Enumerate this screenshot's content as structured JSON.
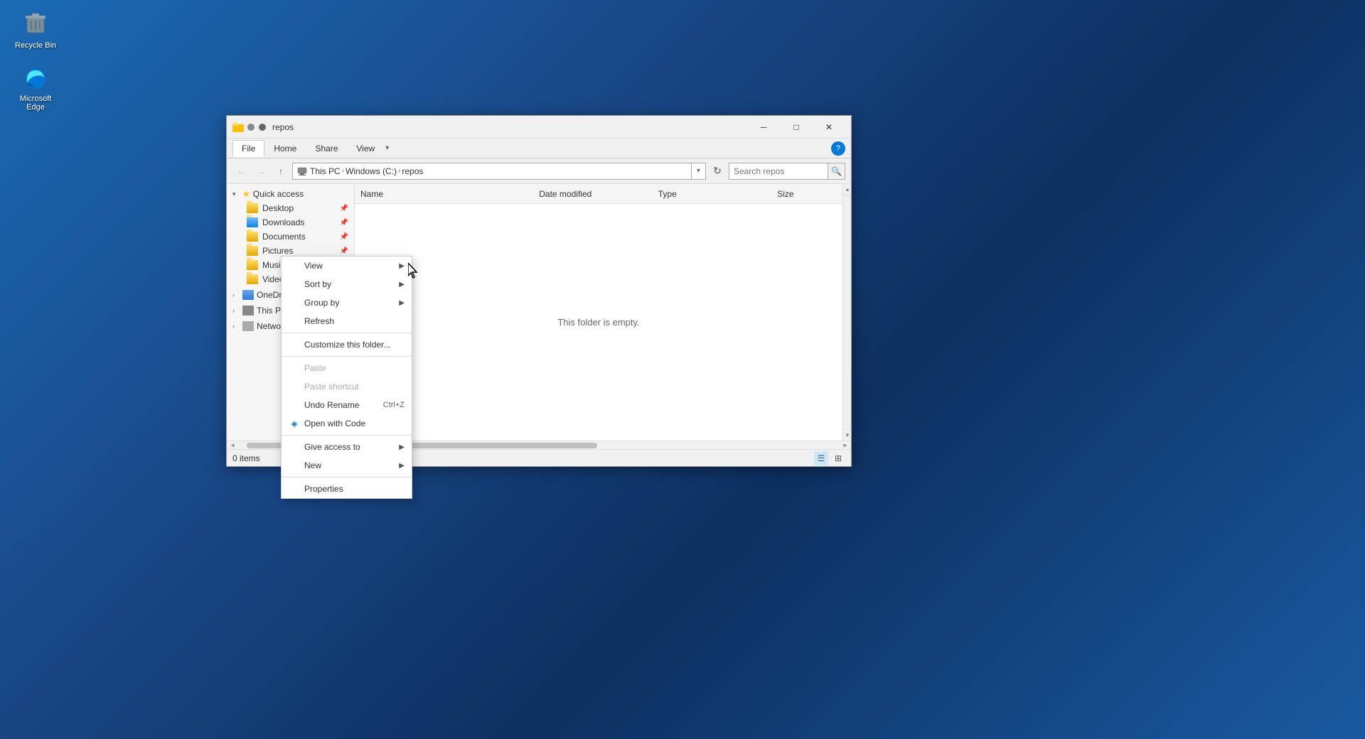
{
  "desktop": {
    "recyclebin": {
      "label": "Recycle Bin"
    },
    "edge": {
      "label": "Microsoft Edge"
    }
  },
  "window": {
    "title": "repos",
    "titlebar": {
      "minimize": "─",
      "maximize": "□",
      "close": "✕"
    },
    "tabs": [
      {
        "label": "File",
        "active": true
      },
      {
        "label": "Home",
        "active": false
      },
      {
        "label": "Share",
        "active": false
      },
      {
        "label": "View",
        "active": false
      }
    ],
    "address": {
      "path_parts": [
        "This PC",
        "Windows (C:)",
        "repos"
      ],
      "search_placeholder": "Search repos",
      "search_value": ""
    },
    "sidebar": {
      "sections": [
        {
          "label": "Quick access",
          "expanded": true,
          "items": [
            {
              "label": "Desktop",
              "pinned": true
            },
            {
              "label": "Downloads",
              "pinned": true
            },
            {
              "label": "Documents",
              "pinned": true
            },
            {
              "label": "Pictures",
              "pinned": true
            },
            {
              "label": "Music",
              "pinned": false
            },
            {
              "label": "Videos",
              "pinned": false
            }
          ]
        },
        {
          "label": "OneDrive",
          "expanded": false,
          "items": []
        },
        {
          "label": "This PC",
          "expanded": false,
          "items": []
        },
        {
          "label": "Network",
          "expanded": false,
          "items": []
        }
      ]
    },
    "content": {
      "columns": [
        "Name",
        "Date modified",
        "Type",
        "Size"
      ],
      "empty_message": "This folder is empty."
    },
    "statusbar": {
      "items_count": "0 items"
    },
    "context_menu": {
      "items": [
        {
          "label": "View",
          "has_submenu": true,
          "icon": "",
          "disabled": false
        },
        {
          "label": "Sort by",
          "has_submenu": true,
          "icon": "",
          "disabled": false
        },
        {
          "label": "Group by",
          "has_submenu": true,
          "icon": "",
          "disabled": false
        },
        {
          "label": "Refresh",
          "has_submenu": false,
          "icon": "",
          "disabled": false
        },
        {
          "separator": true
        },
        {
          "label": "Customize this folder...",
          "has_submenu": false,
          "icon": "",
          "disabled": false
        },
        {
          "separator": true
        },
        {
          "label": "Paste",
          "has_submenu": false,
          "icon": "",
          "disabled": true
        },
        {
          "label": "Paste shortcut",
          "has_submenu": false,
          "icon": "",
          "disabled": true
        },
        {
          "label": "Undo Rename",
          "shortcut": "Ctrl+Z",
          "has_submenu": false,
          "icon": "",
          "disabled": false
        },
        {
          "label": "Open with Code",
          "has_submenu": false,
          "icon": "◈",
          "disabled": false
        },
        {
          "separator": true
        },
        {
          "label": "Give access to",
          "has_submenu": true,
          "icon": "",
          "disabled": false
        },
        {
          "label": "New",
          "has_submenu": true,
          "icon": "",
          "disabled": false
        },
        {
          "separator": true
        },
        {
          "label": "Properties",
          "has_submenu": false,
          "icon": "",
          "disabled": false
        }
      ]
    }
  }
}
